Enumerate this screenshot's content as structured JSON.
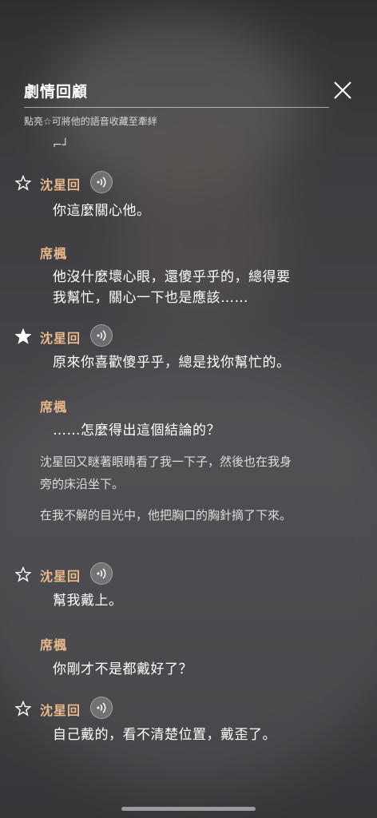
{
  "header": {
    "title": "劇情回顧",
    "subtitle": "點亮☆可將他的語音收藏至牽絆"
  },
  "fragment_text": "⌐┘",
  "entries": [
    {
      "speaker": "沈星回",
      "text": "你這麼關心他。",
      "starred": false,
      "has_voice": true
    },
    {
      "speaker": "席楓",
      "text_lines": [
        "他沒什麼壞心眼，還傻乎乎的，總得要",
        "我幫忙，關心一下也是應該……"
      ]
    },
    {
      "speaker": "沈星回",
      "text": "原來你喜歡傻乎乎，總是找你幫忙的。",
      "starred": true,
      "has_voice": true
    },
    {
      "speaker": "席楓",
      "text": "……怎麼得出這個結論的？"
    },
    {
      "speaker": "沈星回",
      "text": "幫我戴上。",
      "starred": false,
      "has_voice": true
    },
    {
      "speaker": "席楓",
      "text": "你剛才不是都戴好了？"
    },
    {
      "speaker": "沈星回",
      "text": "自己戴的，看不清楚位置，戴歪了。",
      "starred": false,
      "has_voice": true
    }
  ],
  "narration": {
    "n1": [
      "沈星回又瞇著眼睛看了我一下子，然後也在我身",
      "旁的床沿坐下。"
    ],
    "n2": "在我不解的目光中，他把胸口的胸針摘了下來。"
  },
  "colors": {
    "speaker": "#e7b98a",
    "text": "#ffffff",
    "narration": "#dddddd"
  }
}
